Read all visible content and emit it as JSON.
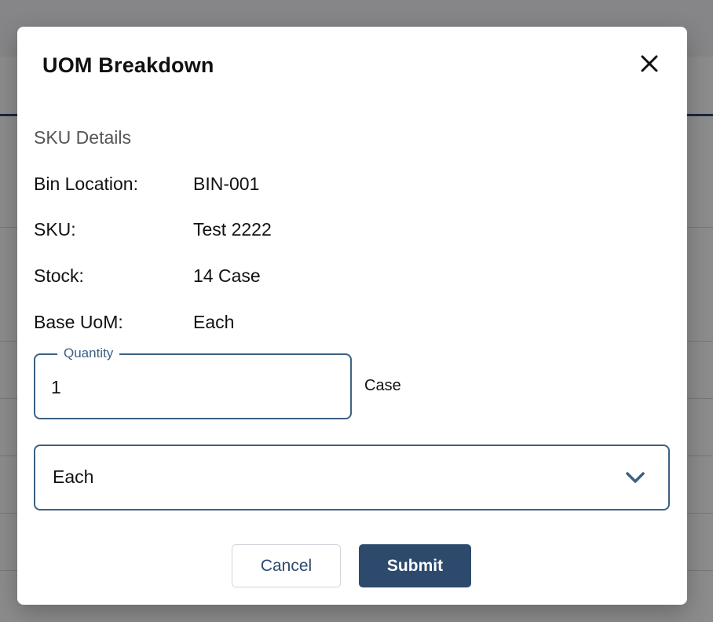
{
  "modal": {
    "title": "UOM Breakdown",
    "section_title": "SKU Details",
    "details": [
      {
        "label": "Bin Location:",
        "value": "BIN-001"
      },
      {
        "label": "SKU:",
        "value": "Test 2222"
      },
      {
        "label": "Stock:",
        "value": "14 Case"
      },
      {
        "label": "Base UoM:",
        "value": "Each"
      }
    ],
    "quantity": {
      "label": "Quantity",
      "value": "1",
      "unit": "Case"
    },
    "uom_select": {
      "selected": "Each"
    },
    "buttons": {
      "cancel": "Cancel",
      "submit": "Submit"
    }
  },
  "colors": {
    "primary": "#2d4a6d",
    "field_border": "#3c6182",
    "overlay": "#000000"
  },
  "icons": {
    "close": "close-icon",
    "dropdown": "chevron-down-icon"
  }
}
